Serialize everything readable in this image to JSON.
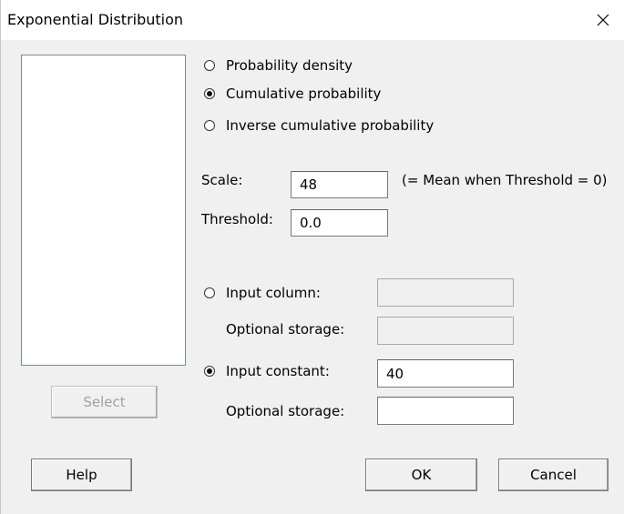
{
  "window": {
    "title": "Exponential Distribution",
    "close_icon": "close-icon"
  },
  "variable_list": {
    "items": []
  },
  "select_button": {
    "label": "Select",
    "enabled": false
  },
  "distribution_options": {
    "probability_density": {
      "label": "Probability density",
      "selected": false
    },
    "cumulative_probability": {
      "label": "Cumulative probability",
      "selected": true
    },
    "inverse_cumulative_probability": {
      "label": "Inverse cumulative probability",
      "selected": false
    }
  },
  "parameters": {
    "scale": {
      "label": "Scale:",
      "value": "48",
      "note": "(= Mean when Threshold = 0)"
    },
    "threshold": {
      "label": "Threshold:",
      "value": "0.0"
    }
  },
  "input_column": {
    "label": "Input column:",
    "value": "",
    "selected": false,
    "optional_storage": {
      "label": "Optional storage:",
      "value": ""
    }
  },
  "input_constant": {
    "label": "Input constant:",
    "value": "40",
    "selected": true,
    "optional_storage": {
      "label": "Optional storage:",
      "value": ""
    }
  },
  "footer": {
    "help_label": "Help",
    "ok_label": "OK",
    "cancel_label": "Cancel"
  }
}
